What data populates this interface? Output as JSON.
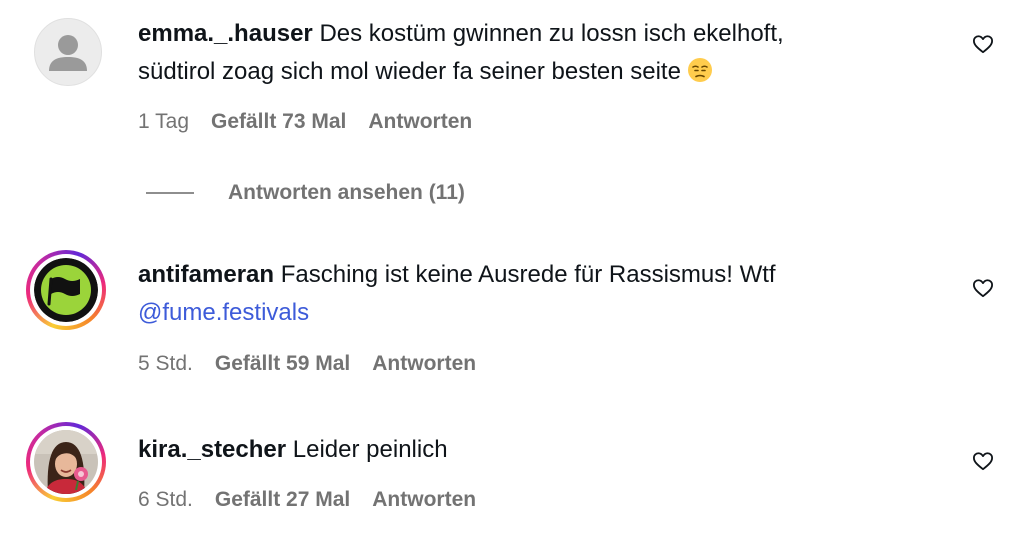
{
  "comments": [
    {
      "username": "emma._.hauser",
      "text_line1": "Des kostüm gwinnen zu lossn isch ekelhoft,",
      "text_line2": "südtirol zoag sich mol wieder fa seiner besten seite",
      "emoji": "unamused-face",
      "time": "1 Tag",
      "likes": "Gefällt 73 Mal",
      "reply_label": "Antworten",
      "avatar": "default-person-icon"
    },
    {
      "username": "antifameran",
      "text_line1": "Fasching ist keine Ausrede für Rassismus! Wtf",
      "mention": "@fume.festivals",
      "time": "5 Std.",
      "likes": "Gefällt 59 Mal",
      "reply_label": "Antworten",
      "avatar": "antifa-flag-logo"
    },
    {
      "username": "kira._stecher",
      "text_line1": "Leider peinlich",
      "time": "6 Std.",
      "likes": "Gefällt 27 Mal",
      "reply_label": "Antworten",
      "avatar": "profile-photo"
    }
  ],
  "view_replies": {
    "label": "Antworten ansehen (11)"
  },
  "colors": {
    "mention": "#3d5bd9",
    "meta": "#737373",
    "logo_green": "#9bd43a"
  }
}
